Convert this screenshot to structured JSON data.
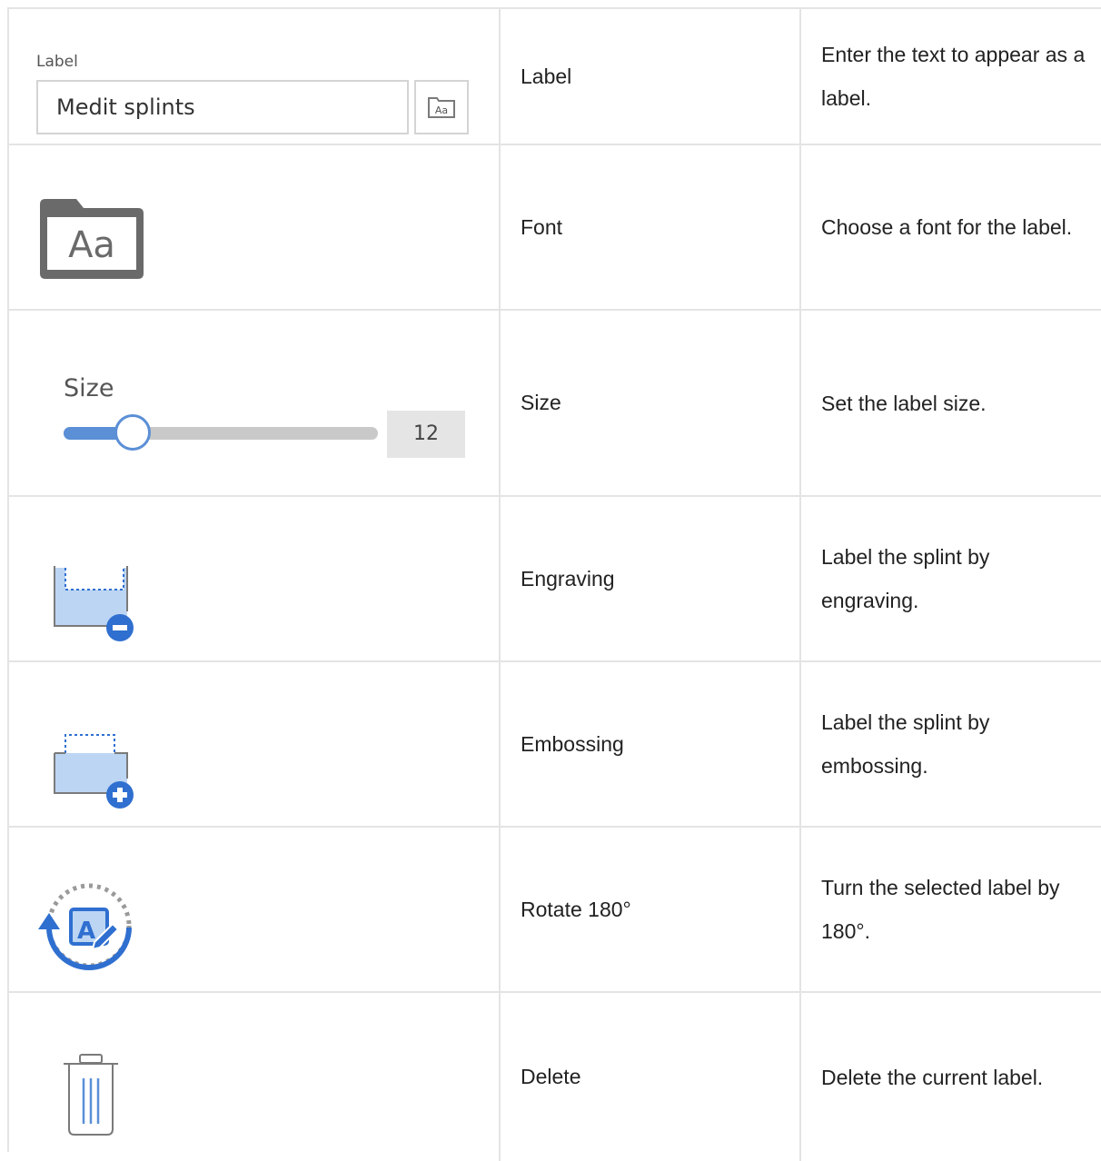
{
  "rows": [
    {
      "name": "Label",
      "description": "Enter the text to appear as a label.",
      "widget": {
        "caption": "Label",
        "value": "Medit splints",
        "font_button_icon": "font-folder-icon"
      }
    },
    {
      "name": "Font",
      "description": "Choose a font for the label.",
      "icon": "font-folder-icon",
      "icon_text": "Aa"
    },
    {
      "name": "Size",
      "description": "Set the label size.",
      "widget": {
        "caption": "Size",
        "value": "12",
        "slider_fraction": 0.22
      }
    },
    {
      "name": "Engraving",
      "description": "Label the splint by engraving.",
      "icon": "engrave-icon"
    },
    {
      "name": "Embossing",
      "description": "Label the splint by embossing.",
      "icon": "emboss-icon"
    },
    {
      "name": "Rotate 180°",
      "description": "Turn the selected label by 180°.",
      "icon": "rotate-icon",
      "icon_text": "A"
    },
    {
      "name": "Delete",
      "description": "Delete the current label.",
      "icon": "trash-icon"
    }
  ],
  "colors": {
    "accent_blue": "#2f6fd0",
    "light_blue": "#bcd5f3",
    "border": "#e4e4e4",
    "icon_gray": "#6a6a6a"
  }
}
